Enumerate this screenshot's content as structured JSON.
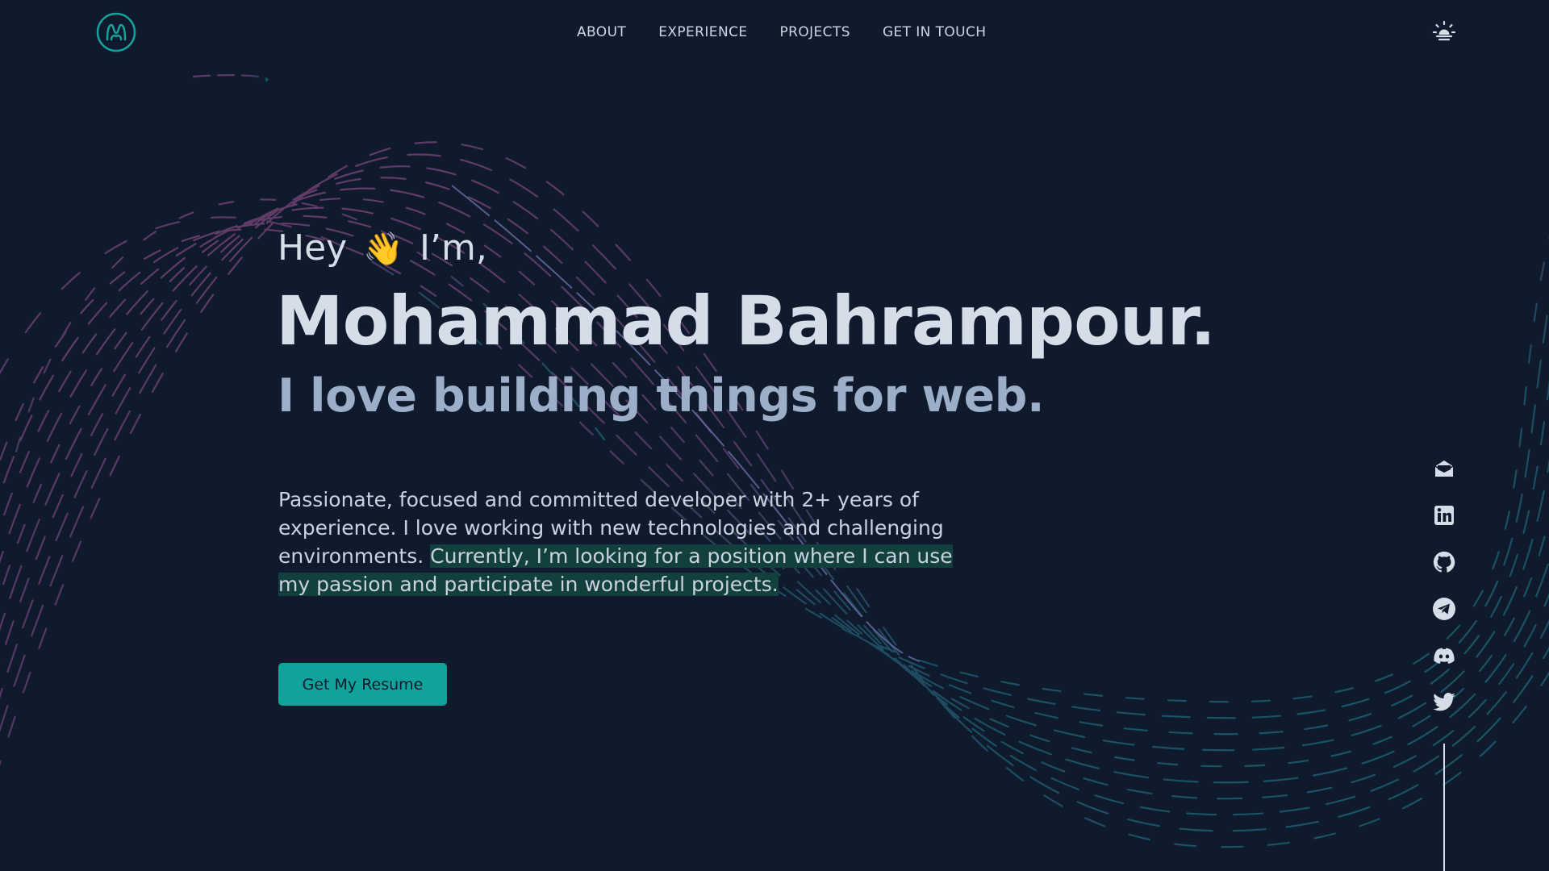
{
  "colors": {
    "background": "#0f1a2c",
    "accent": "#0fa39b",
    "text_primary": "#d5dde9",
    "text_secondary": "#9caec8",
    "highlight_bg": "#12403f"
  },
  "header": {
    "logo_icon": "m-logo-icon",
    "nav": [
      {
        "label": "ABOUT"
      },
      {
        "label": "EXPERIENCE"
      },
      {
        "label": "PROJECTS"
      },
      {
        "label": "GET IN TOUCH"
      }
    ],
    "theme_toggle_icon": "sun-icon"
  },
  "hero": {
    "greeting_before": "Hey",
    "greeting_emoji": "👋",
    "greeting_after": "I’m,",
    "name": "Mohammad Bahrampour.",
    "tagline": "I love building things for web.",
    "bio_plain": "Passionate, focused and committed developer with 2+ years of experience. I love working with new technologies and challenging environments. ",
    "bio_highlight": "Currently, I’m looking for a position where I can use my passion and participate in wonderful projects.",
    "resume_button": "Get My Resume"
  },
  "social": [
    {
      "icon": "email-icon"
    },
    {
      "icon": "linkedin-icon"
    },
    {
      "icon": "github-icon"
    },
    {
      "icon": "telegram-icon"
    },
    {
      "icon": "discord-icon"
    },
    {
      "icon": "twitter-icon"
    }
  ]
}
